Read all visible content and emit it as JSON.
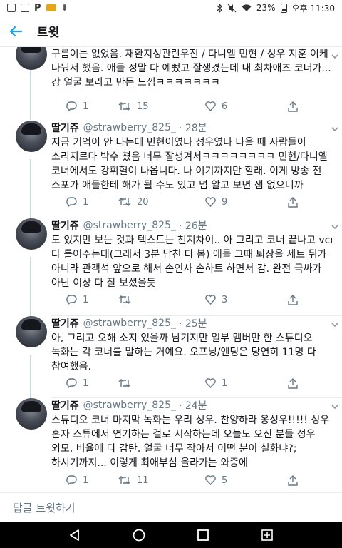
{
  "status_bar": {
    "battery": "23%",
    "time": "오후 11:30",
    "app_p_icon": "P"
  },
  "header": {
    "title": "트윗"
  },
  "tweets": [
    {
      "name": "",
      "handle": "",
      "time": "",
      "lines": [
        "구름이는 없었음. 재환지성관린우진 / 다니엘 민현 / 성우 지훈 이케",
        "나눠서 했음. 애들 정말 다 예뻤고 잘생겼는데 내 최차애즈 코너가...",
        "강 얼굴 보라고 만든 느낌ㅋㅋㅋㅋㅋㅋㅋ"
      ],
      "replies": "1",
      "retweets": "15",
      "likes": "6"
    },
    {
      "name": "딸기쥬",
      "handle": "@strawberry_825_",
      "time": "· 28분",
      "lines": [
        "지금 기억이 안 나는데 민현이였나 성우였나 나올 때 사람들이",
        "소리지르다 박수 쳤음 너무 잘생겨서ㅋㅋㅋㅋㅋㅋㅋㅋ 민현/다니엘",
        "코너에서도 강휘혈이 나옵니다. 나 여기까지만 할래. 이게 방송 전",
        "스포가 애들한테 해가 될 수도 있고 넘 알고 보면 잼 없으니까"
      ],
      "replies": "1",
      "retweets": "20",
      "likes": "9"
    },
    {
      "name": "딸기쥬",
      "handle": "@strawberry_825_",
      "time": "· 26분",
      "lines": [
        "도 있지만 보는 것과 텍스트는 천지차이.. 아 그리고 코너 끝나고 vcr",
        "다 틀어주는데(그래서 3분 남친 다 봄) 애들 그때 퇴장을 세트 뒤가",
        "아니라 관객석 앞으로 해서 손인사 손하트 하면서 감. 완전 극싸가",
        "아닌 이상 다 잘 보셨을듯"
      ],
      "replies": "1",
      "retweets": "",
      "likes": "3"
    },
    {
      "name": "딸기쥬",
      "handle": "@strawberry_825_",
      "time": "· 25분",
      "lines": [
        "아, 그리고 오해 소지 있을까 남기지만 일부 멤버만 한 스튜디오",
        "녹화는 각 코너를 말하는 거예요. 오프닝/엔딩은 당연히 11명 다",
        "참여했음."
      ],
      "replies": "1",
      "retweets": "",
      "likes": "1"
    },
    {
      "name": "딸기쥬",
      "handle": "@strawberry_825_",
      "time": "· 24분",
      "lines": [
        "스튜디오 코너 마지막 녹화는 우리 성우. 찬양하라 옹성우!!!!! 성우",
        "혼자 스튜에서 연기하는 걸로 시작하는데 오늘도 오신 분들 성우",
        "외모, 비율에 다 감탄. 얼굴 너무 작아서 어떤 분이 실화냐?;",
        "하시기까지... 이렇게 최애부심 올라가는 와중에"
      ],
      "replies": "1",
      "retweets": "11",
      "likes": "5"
    }
  ],
  "reply_bar": {
    "placeholder": "답글 트윗하기"
  }
}
